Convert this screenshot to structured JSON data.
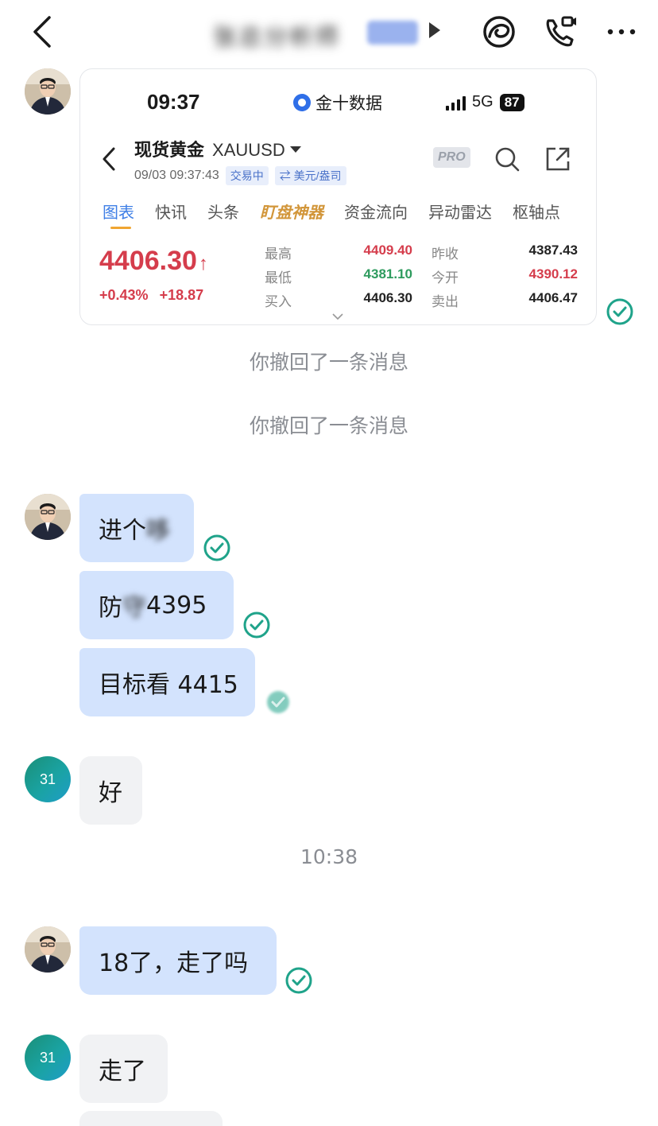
{
  "header": {
    "back_icon": "chevron-left-icon",
    "contact_name_blurred": "张总分析师",
    "contact_tag_blurred": "客服部",
    "icons": [
      "moments-icon",
      "video-call-icon",
      "more-icon"
    ]
  },
  "card": {
    "time": "09:37",
    "app_name": "金十数据",
    "network": "5G",
    "battery": "87",
    "instrument_name": "现货黄金",
    "symbol": "XAUUSD",
    "datetime": "09/03 09:37:43",
    "status_pill": "交易中",
    "currency_pill": "⇄ 美元/盎司",
    "pro_label": "PRO",
    "tabs": [
      "图表",
      "快讯",
      "头条",
      "盯盘神器",
      "资金流向",
      "异动雷达",
      "枢轴点"
    ],
    "price": "4406.30",
    "change_pct": "+0.43%",
    "change_abs": "+18.87",
    "quotes": {
      "high_label": "最高",
      "high": "4409.40",
      "low_label": "最低",
      "low": "4381.10",
      "buy_label": "买入",
      "buy": "4406.30",
      "prev_close_label": "昨收",
      "prev_close": "4387.43",
      "open_label": "今开",
      "open": "4390.12",
      "sell_label": "卖出",
      "sell": "4406.47"
    }
  },
  "system": {
    "recall_1": "你撤回了一条消息",
    "recall_2": "你撤回了一条消息",
    "timestamp": "10:38"
  },
  "messages": {
    "m1_visible": "进个",
    "m1_blurred": "哆",
    "m2_prefix": "防",
    "m2_blurred": "守",
    "m2_suffix": " 4395",
    "m3_prefix": "目标看 4415",
    "m4": "好",
    "m5": "18了，走了吗",
    "m6": "走了"
  },
  "avatars": {
    "other_label": "31"
  },
  "colors": {
    "my_bubble": "#d3e3fd",
    "their_bubble": "#f1f2f4",
    "read_check": "#1fa38a",
    "price_red": "#d53d4c",
    "price_green": "#2e9b5e"
  }
}
